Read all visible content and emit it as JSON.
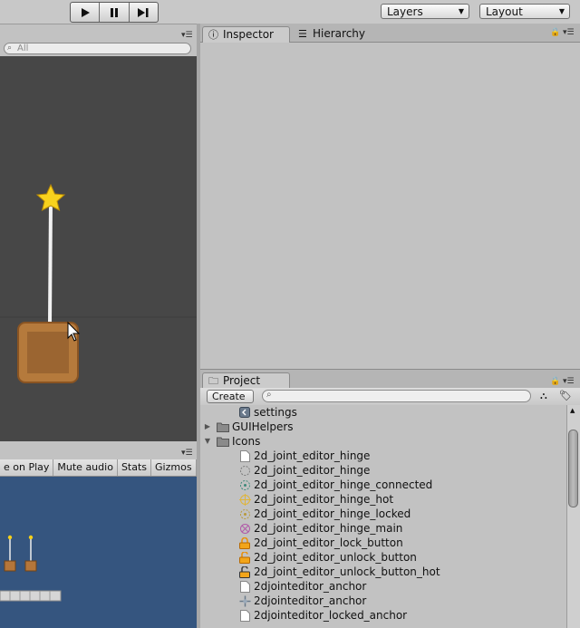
{
  "toolbar": {
    "play_label": "▶",
    "pause_label": "❚❚",
    "step_label": "▶❙",
    "layers": "Layers",
    "layout": "Layout"
  },
  "scene": {
    "search_placeholder": "All"
  },
  "game": {
    "buttons": [
      "e on Play",
      "Mute audio",
      "Stats",
      "Gizmos"
    ]
  },
  "inspector": {
    "tabs": [
      "Inspector",
      "Hierarchy"
    ]
  },
  "project": {
    "tab": "Project",
    "create": "Create",
    "items": [
      {
        "label": "settings",
        "indent": 2,
        "icon": "settings-icon"
      },
      {
        "label": "GUIHelpers",
        "indent": 1,
        "icon": "folder-icon",
        "arrow": "collapsed"
      },
      {
        "label": "Icons",
        "indent": 1,
        "icon": "folder-icon",
        "arrow": "expanded"
      },
      {
        "label": "2d_joint_editor_hinge",
        "indent": 2,
        "icon": "file-icon"
      },
      {
        "label": "2d_joint_editor_hinge",
        "indent": 2,
        "icon": "hinge-icon"
      },
      {
        "label": "2d_joint_editor_hinge_connected",
        "indent": 2,
        "icon": "hinge-connected-icon"
      },
      {
        "label": "2d_joint_editor_hinge_hot",
        "indent": 2,
        "icon": "hinge-hot-icon"
      },
      {
        "label": "2d_joint_editor_hinge_locked",
        "indent": 2,
        "icon": "hinge-locked-icon"
      },
      {
        "label": "2d_joint_editor_hinge_main",
        "indent": 2,
        "icon": "hinge-main-icon"
      },
      {
        "label": "2d_joint_editor_lock_button",
        "indent": 2,
        "icon": "lock-icon"
      },
      {
        "label": "2d_joint_editor_unlock_button",
        "indent": 2,
        "icon": "unlock-icon"
      },
      {
        "label": "2d_joint_editor_unlock_button_hot",
        "indent": 2,
        "icon": "unlock-hot-icon"
      },
      {
        "label": "2djointeditor_anchor",
        "indent": 2,
        "icon": "file-icon"
      },
      {
        "label": "2djointeditor_anchor",
        "indent": 2,
        "icon": "anchor-icon"
      },
      {
        "label": "2djointeditor_locked_anchor",
        "indent": 2,
        "icon": "file-icon"
      }
    ]
  }
}
